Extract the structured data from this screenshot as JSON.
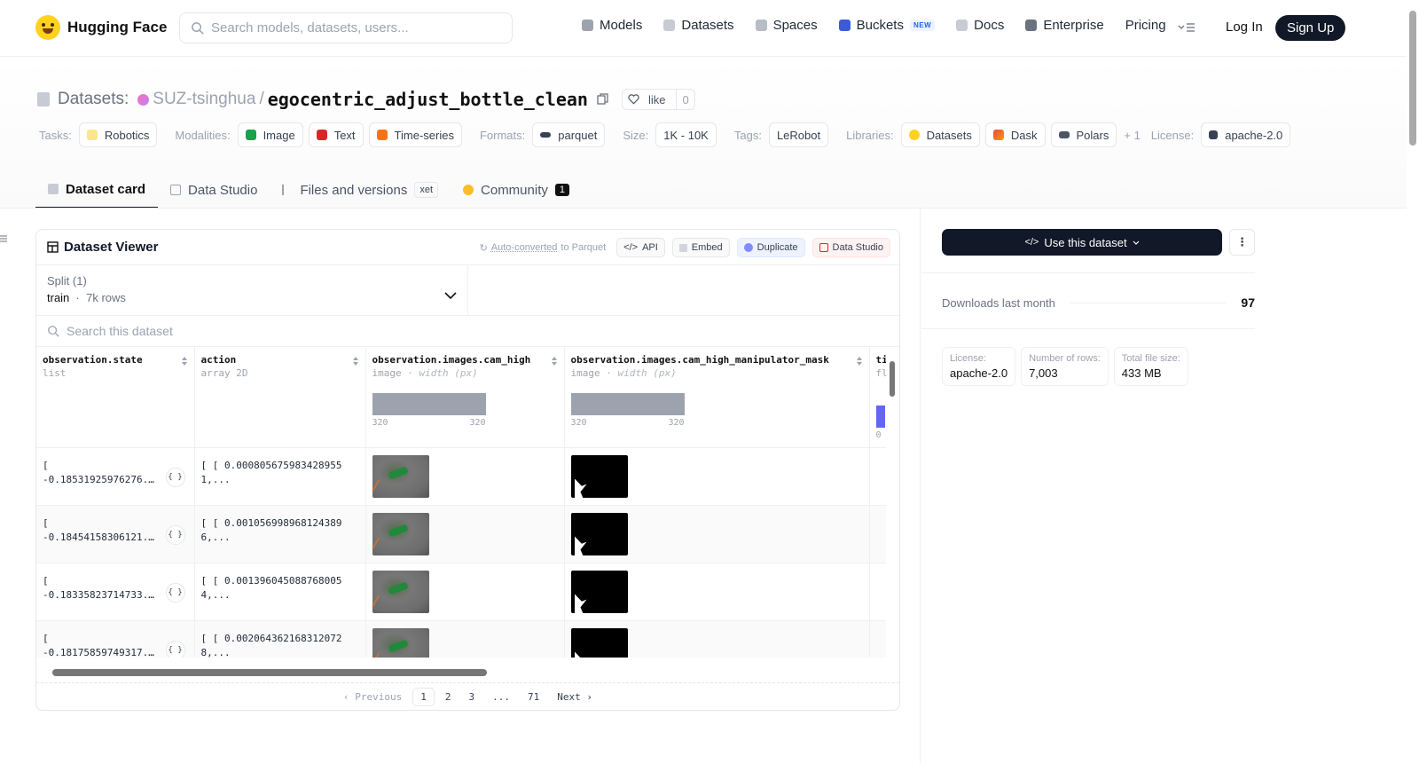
{
  "nav": {
    "brand": "Hugging Face",
    "search_placeholder": "Search models, datasets, users...",
    "links": [
      {
        "label": "Models",
        "color": "#9ca3af"
      },
      {
        "label": "Datasets",
        "color": "#c7cbd3"
      },
      {
        "label": "Spaces",
        "color": "#9ca3af"
      },
      {
        "label": "Buckets",
        "color": "#3b5bdb"
      },
      {
        "label": "Docs",
        "color": "#c7cbd3"
      },
      {
        "label": "Enterprise",
        "color": "#6b7280"
      },
      {
        "label": "Pricing",
        "color": ""
      }
    ],
    "new_badge": "NEW",
    "login": "Log In",
    "signup": "Sign Up"
  },
  "header": {
    "crumb_label": "Datasets:",
    "org": "SUZ-tsinghua",
    "slash": "/",
    "dataset_name": "egocentric_adjust_bottle_clean",
    "like_label": "like",
    "like_count": "0",
    "tag_groups": {
      "tasks_label": "Tasks:",
      "tasks": [
        "Robotics"
      ],
      "modalities_label": "Modalities:",
      "modalities": [
        "Image",
        "Text",
        "Time-series"
      ],
      "formats_label": "Formats:",
      "formats": [
        "parquet"
      ],
      "size_label": "Size:",
      "size": [
        "1K - 10K"
      ],
      "tags_label": "Tags:",
      "tags": [
        "LeRobot"
      ],
      "libraries_label": "Libraries:",
      "libraries": [
        "Datasets",
        "Dask",
        "Polars"
      ],
      "more": "+ 1",
      "license_label": "License:",
      "license": [
        "apache-2.0"
      ]
    }
  },
  "tabs": [
    {
      "label": "Dataset card"
    },
    {
      "label": "Data Studio"
    },
    {
      "label": "Files and versions",
      "badge": "xet"
    },
    {
      "label": "Community",
      "badge": "1"
    }
  ],
  "viewer": {
    "title": "Dataset Viewer",
    "auto_converted_link": "Auto-converted",
    "auto_converted_rest": " to Parquet",
    "api": "API",
    "embed": "Embed",
    "duplicate": "Duplicate",
    "data_studio": "Data Studio",
    "split_label": "Split (1)",
    "split_value": "train",
    "split_rows": "7k rows",
    "search_placeholder": "Search this dataset",
    "columns": [
      {
        "name": "observation.state",
        "type": "list",
        "type_extra": ""
      },
      {
        "name": "action",
        "type": "array 2D",
        "type_extra": ""
      },
      {
        "name": "observation.images.cam_high",
        "type": "image",
        "type_extra": "· width (px)",
        "hist_min": "320",
        "hist_max": "320"
      },
      {
        "name": "observation.images.cam_high_manipulator_mask",
        "type": "image",
        "type_extra": "· width (px)",
        "hist_min": "320",
        "hist_max": "320"
      },
      {
        "name": "ti",
        "type": "fl",
        "type_extra": "",
        "hist_min": "0"
      }
    ],
    "rows": [
      {
        "state": "[ -0.18531925976276...",
        "action": "[ [ 0.0008056759834289551,..."
      },
      {
        "state": "[ -0.18454158306121...",
        "action": "[ [ 0.0010569989681243896,..."
      },
      {
        "state": "[ -0.18335823714733...",
        "action": "[ [ 0.0013960450887680054,..."
      },
      {
        "state": "[ -0.18175859749317...",
        "action": "[ [ 0.0020643621683120728,..."
      }
    ],
    "pager": {
      "prev": "‹ Previous",
      "pages": [
        "1",
        "2",
        "3",
        "...",
        "71"
      ],
      "next": "Next ›",
      "current": "1"
    }
  },
  "sidebar": {
    "use_button": "Use this dataset",
    "downloads_label": "Downloads last month",
    "downloads_value": "97",
    "stats": [
      {
        "k": "License:",
        "v": "apache-2.0"
      },
      {
        "k": "Number of rows:",
        "v": "7,003"
      },
      {
        "k": "Total file size:",
        "v": "433 MB"
      }
    ]
  }
}
